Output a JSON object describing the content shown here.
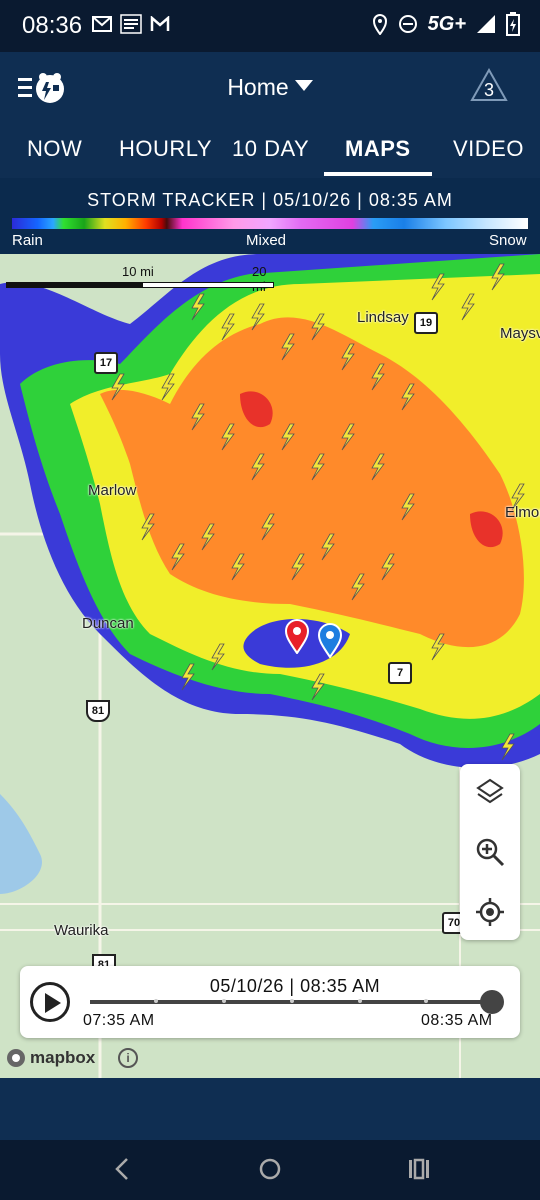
{
  "status": {
    "time": "08:36",
    "network": "5G+"
  },
  "header": {
    "title": "Home",
    "alert_count": "3"
  },
  "tabs": [
    {
      "label": "NOW"
    },
    {
      "label": "HOURLY"
    },
    {
      "label": "10 DAY"
    },
    {
      "label": "MAPS"
    },
    {
      "label": "VIDEO"
    }
  ],
  "legend": {
    "title": "STORM TRACKER | 05/10/26 | 08:35 AM",
    "rain": "Rain",
    "mixed": "Mixed",
    "snow": "Snow"
  },
  "scale": {
    "mid": "10 mi",
    "end": "20 mi"
  },
  "places": {
    "lindsay": "Lindsay",
    "maysv": "Maysv",
    "marlow": "Marlow",
    "duncan": "Duncan",
    "elmor": "Elmor",
    "waurika": "Waurika"
  },
  "shields": {
    "r17": "17",
    "r19": "19",
    "r7": "7",
    "us81": "81",
    "r70": "70",
    "us81b": "81"
  },
  "player": {
    "timestamp": "05/10/26 | 08:35 AM",
    "start": "07:35 AM",
    "end": "08:35 AM",
    "progress": 1.0
  },
  "attribution": {
    "brand": "mapbox"
  },
  "icons": {
    "menu": "menu-logo-icon",
    "alert": "alert-triangle-icon",
    "layers": "layers-icon",
    "zoom": "zoom-in-icon",
    "locate": "locate-icon",
    "play": "play-icon",
    "info": "info-icon",
    "pin_red": "red-location-pin-icon",
    "pin_blue": "blue-location-pin-icon"
  },
  "colors": {
    "header_bg": "#0f2e52",
    "radar_green": "#2fd13a",
    "radar_yellow": "#f1ee2a",
    "radar_orange": "#ff8a2a",
    "radar_blue": "#3a3ad8"
  }
}
